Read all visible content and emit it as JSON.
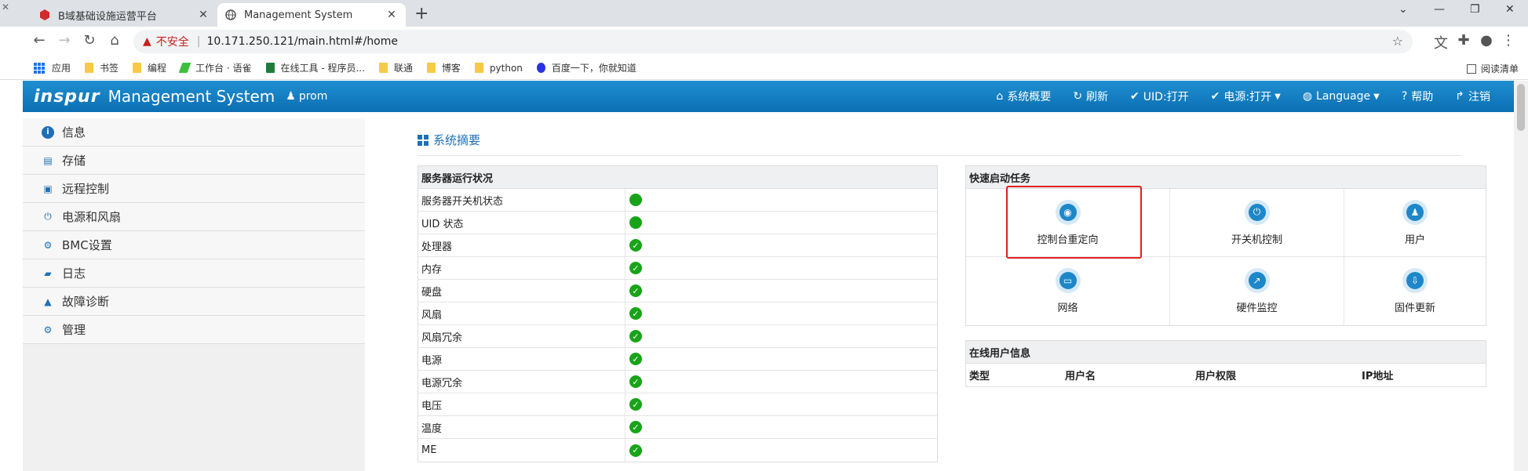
{
  "browser": {
    "tabs": [
      {
        "title": "B域基础设施运营平台",
        "active": false
      },
      {
        "title": "Management System",
        "active": true
      }
    ],
    "security_label": "不安全",
    "url": "10.171.250.121/main.html#/home",
    "bookmarks": [
      "应用",
      "书签",
      "编程",
      "工作台 · 语雀",
      "在线工具 - 程序员...",
      "联通",
      "博客",
      "python",
      "百度一下，你就知道"
    ],
    "reading_list": "阅读清单"
  },
  "app": {
    "logo": "inspur",
    "title": "Management System",
    "user": "prom",
    "nav": [
      {
        "label": "系统概要",
        "icon": "home-icon"
      },
      {
        "label": "刷新",
        "icon": "refresh-icon"
      },
      {
        "label": "UID:打开",
        "icon": "check-icon"
      },
      {
        "label": "电源:打开",
        "icon": "check-icon",
        "dropdown": true
      },
      {
        "label": "Language",
        "icon": "globe-icon",
        "dropdown": true
      },
      {
        "label": "帮助",
        "icon": "question-icon"
      },
      {
        "label": "注销",
        "icon": "logout-icon"
      }
    ],
    "accent_color": "#1f8fd1"
  },
  "sidebar": {
    "items": [
      {
        "label": "信息",
        "icon": "info-icon"
      },
      {
        "label": "存储",
        "icon": "storage-icon"
      },
      {
        "label": "远程控制",
        "icon": "remote-icon"
      },
      {
        "label": "电源和风扇",
        "icon": "power-icon"
      },
      {
        "label": "BMC设置",
        "icon": "gear-icon"
      },
      {
        "label": "日志",
        "icon": "log-icon"
      },
      {
        "label": "故障诊断",
        "icon": "warning-icon"
      },
      {
        "label": "管理",
        "icon": "gears-icon"
      }
    ]
  },
  "main": {
    "breadcrumb": "系统摘要",
    "status": {
      "title": "服务器运行状况",
      "rows": [
        {
          "label": "服务器开关机状态",
          "state": "on"
        },
        {
          "label": "UID 状态",
          "state": "on"
        },
        {
          "label": "处理器",
          "state": "ok"
        },
        {
          "label": "内存",
          "state": "ok"
        },
        {
          "label": "硬盘",
          "state": "ok"
        },
        {
          "label": "风扇",
          "state": "ok"
        },
        {
          "label": "风扇冗余",
          "state": "ok"
        },
        {
          "label": "电源",
          "state": "ok"
        },
        {
          "label": "电源冗余",
          "state": "ok"
        },
        {
          "label": "电压",
          "state": "ok"
        },
        {
          "label": "温度",
          "state": "ok"
        },
        {
          "label": "ME",
          "state": "ok"
        }
      ],
      "ok_color": "#18a418"
    },
    "quick": {
      "title": "快速启动任务",
      "tasks": [
        {
          "label": "控制台重定向",
          "icon": "broadcast-icon",
          "highlighted": true
        },
        {
          "label": "开关机控制",
          "icon": "power-icon"
        },
        {
          "label": "用户",
          "icon": "user-icon"
        },
        {
          "label": "网络",
          "icon": "monitor-icon"
        },
        {
          "label": "硬件监控",
          "icon": "chart-icon"
        },
        {
          "label": "固件更新",
          "icon": "download-icon"
        }
      ]
    },
    "users": {
      "title": "在线用户信息",
      "columns": [
        "类型",
        "用户名",
        "用户权限",
        "IP地址"
      ],
      "rows": []
    }
  }
}
